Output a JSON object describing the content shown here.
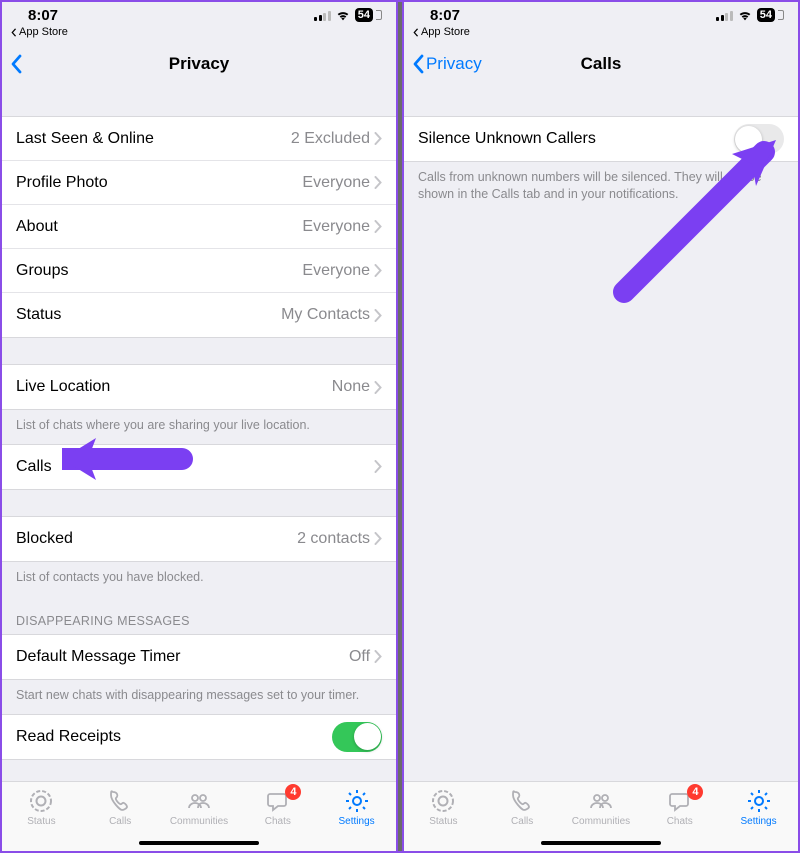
{
  "status": {
    "time": "8:07",
    "battery": "54",
    "breadcrumb": "App Store"
  },
  "left": {
    "nav": {
      "title": "Privacy"
    },
    "rows": {
      "lastseen": {
        "label": "Last Seen & Online",
        "value": "2 Excluded"
      },
      "photo": {
        "label": "Profile Photo",
        "value": "Everyone"
      },
      "about": {
        "label": "About",
        "value": "Everyone"
      },
      "groups": {
        "label": "Groups",
        "value": "Everyone"
      },
      "status": {
        "label": "Status",
        "value": "My Contacts"
      },
      "livelocation": {
        "label": "Live Location",
        "value": "None"
      },
      "calls": {
        "label": "Calls",
        "value": ""
      },
      "blocked": {
        "label": "Blocked",
        "value": "2 contacts"
      },
      "timer": {
        "label": "Default Message Timer",
        "value": "Off"
      },
      "receipts": {
        "label": "Read Receipts"
      }
    },
    "captions": {
      "livelocation": "List of chats where you are sharing your live location.",
      "blocked": "List of contacts you have blocked.",
      "timer": "Start new chats with disappearing messages set to your timer."
    },
    "section_headers": {
      "disappearing": "Disappearing Messages"
    }
  },
  "right": {
    "nav": {
      "back": "Privacy",
      "title": "Calls"
    },
    "row": {
      "label": "Silence Unknown Callers"
    },
    "caption": "Calls from unknown numbers will be silenced. They will still be shown in the Calls tab and in your notifications."
  },
  "tabs": {
    "status": "Status",
    "calls": "Calls",
    "communities": "Communities",
    "chats": "Chats",
    "settings": "Settings",
    "chats_badge": "4"
  }
}
